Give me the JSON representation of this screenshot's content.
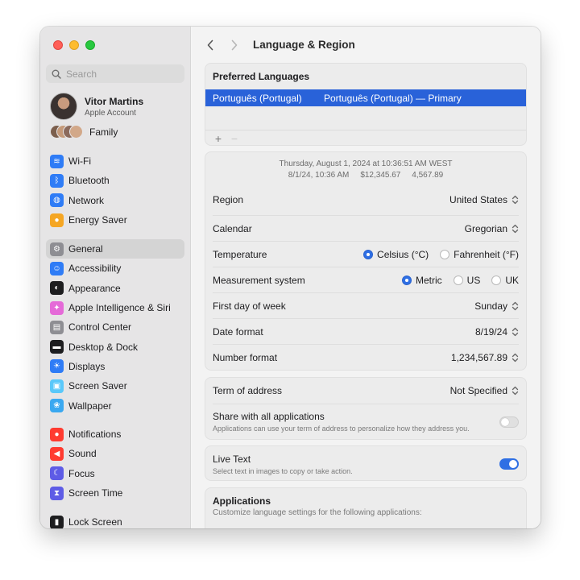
{
  "window": {
    "title": "Language & Region"
  },
  "sidebar": {
    "search_placeholder": "Search",
    "account": {
      "name": "Vitor Martins",
      "subtitle": "Apple Account"
    },
    "family_label": "Family",
    "groups": [
      [
        {
          "label": "Wi-Fi",
          "icon": "wifi-icon",
          "color": "#2f7cf6"
        },
        {
          "label": "Bluetooth",
          "icon": "bluetooth-icon",
          "color": "#2f7cf6"
        },
        {
          "label": "Network",
          "icon": "network-globe-icon",
          "color": "#2f7cf6"
        },
        {
          "label": "Energy Saver",
          "icon": "energy-bulb-icon",
          "color": "#f5a623"
        }
      ],
      [
        {
          "label": "General",
          "icon": "gear-icon",
          "color": "#8e8e93",
          "selected": true
        },
        {
          "label": "Accessibility",
          "icon": "accessibility-icon",
          "color": "#2f7cf6"
        },
        {
          "label": "Appearance",
          "icon": "appearance-icon",
          "color": "#1d1d1f"
        },
        {
          "label": "Apple Intelligence & Siri",
          "icon": "siri-icon",
          "color": "#e56ad8"
        },
        {
          "label": "Control Center",
          "icon": "control-center-icon",
          "color": "#8e8e93"
        },
        {
          "label": "Desktop & Dock",
          "icon": "dock-icon",
          "color": "#1d1d1f"
        },
        {
          "label": "Displays",
          "icon": "displays-sun-icon",
          "color": "#2f7cf6"
        },
        {
          "label": "Screen Saver",
          "icon": "screen-saver-icon",
          "color": "#5ac8fa"
        },
        {
          "label": "Wallpaper",
          "icon": "wallpaper-icon",
          "color": "#3aa8f0"
        }
      ],
      [
        {
          "label": "Notifications",
          "icon": "notifications-bell-icon",
          "color": "#ff3b30"
        },
        {
          "label": "Sound",
          "icon": "sound-speaker-icon",
          "color": "#ff3b30"
        },
        {
          "label": "Focus",
          "icon": "focus-moon-icon",
          "color": "#5e5ce6"
        },
        {
          "label": "Screen Time",
          "icon": "screen-time-hourglass-icon",
          "color": "#5e5ce6"
        }
      ],
      [
        {
          "label": "Lock Screen",
          "icon": "lock-icon",
          "color": "#1d1d1f"
        }
      ]
    ]
  },
  "preferred_languages": {
    "title": "Preferred Languages",
    "rows": [
      {
        "name": "Português (Portugal)",
        "detail": "Português (Portugal) — Primary"
      }
    ],
    "add_label": "+",
    "remove_label": "−"
  },
  "format_preview": {
    "line1": "Thursday, August 1, 2024 at 10:36:51 AM WEST",
    "line2_date": "8/1/24, 10:36 AM",
    "line2_currency": "$12,345.67",
    "line2_number": "4,567.89"
  },
  "settings": {
    "region": {
      "label": "Region",
      "value": "United States"
    },
    "calendar": {
      "label": "Calendar",
      "value": "Gregorian"
    },
    "temperature": {
      "label": "Temperature",
      "options": [
        "Celsius (°C)",
        "Fahrenheit (°F)"
      ],
      "selected": "Celsius (°C)"
    },
    "measurement": {
      "label": "Measurement system",
      "options": [
        "Metric",
        "US",
        "UK"
      ],
      "selected": "Metric"
    },
    "first_day": {
      "label": "First day of week",
      "value": "Sunday"
    },
    "date_format": {
      "label": "Date format",
      "value": "8/19/24"
    },
    "number_format": {
      "label": "Number format",
      "value": "1,234,567.89"
    }
  },
  "address": {
    "term_label": "Term of address",
    "term_value": "Not Specified",
    "share_label": "Share with all applications",
    "share_sub": "Applications can use your term of address to personalize how they address you.",
    "share_on": false
  },
  "live_text": {
    "label": "Live Text",
    "sub": "Select text in images to copy or take action.",
    "on": true
  },
  "applications": {
    "title": "Applications",
    "sub": "Customize language settings for the following applications:"
  }
}
